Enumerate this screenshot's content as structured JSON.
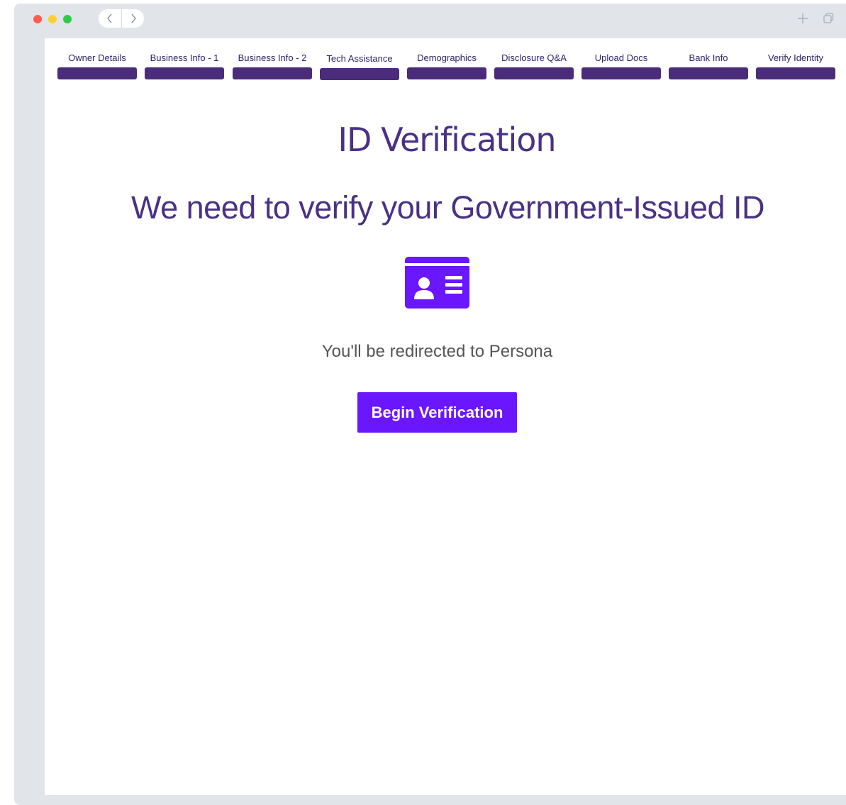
{
  "browser": {
    "traffic_lights": [
      "close",
      "minimize",
      "zoom"
    ],
    "back_icon": "chevron-left-icon",
    "forward_icon": "chevron-right-icon",
    "new_tab_icon": "plus-icon",
    "tabs_icon": "tabs-overview-icon"
  },
  "steps": [
    {
      "label": "Owner Details"
    },
    {
      "label": "Business Info - 1"
    },
    {
      "label": "Business Info - 2"
    },
    {
      "label": "Tech Assistance"
    },
    {
      "label": "Demographics"
    },
    {
      "label": "Disclosure Q&A"
    },
    {
      "label": "Upload Docs"
    },
    {
      "label": "Bank Info"
    },
    {
      "label": "Verify Identity"
    }
  ],
  "main": {
    "title": "ID Verification",
    "subtitle": "We need to verify your Government-Issued ID",
    "icon": "id-card-icon",
    "redirect_text": "You'll be redirected to Persona",
    "begin_button_label": "Begin Verification"
  },
  "colors": {
    "accent": "#6a16ff",
    "step_bar": "#4a2c7b",
    "heading": "#4a3185"
  }
}
